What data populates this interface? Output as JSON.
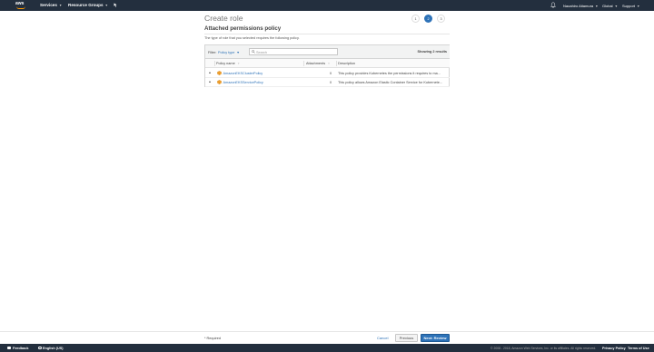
{
  "topbar": {
    "logo": "aws",
    "services": "Services",
    "resource_groups": "Resource Groups",
    "user": "Naoahiro Aitamura",
    "region": "Global",
    "support": "Support"
  },
  "page": {
    "title": "Create role",
    "steps": [
      "1",
      "2",
      "3"
    ],
    "active_step": "2",
    "subtitle": "Attached permissions policy",
    "description": "The type of role that you selected requires the following policy."
  },
  "table": {
    "filter_label": "Filter:",
    "filter_value": "Policy type",
    "search_placeholder": "Search",
    "results": "Showing 2 results",
    "columns": {
      "name": "Policy name",
      "attachments": "Attachments",
      "description": "Description"
    },
    "rows": [
      {
        "name": "AmazonEKSClusterPolicy",
        "attachments": "0",
        "description": "This policy provides Kubernetes the permissions it requires to ma..."
      },
      {
        "name": "AmazonEKSServicePolicy",
        "attachments": "0",
        "description": "This policy allows Amazon Elastic Container Service for Kubernete..."
      }
    ]
  },
  "footer": {
    "required": "* Required",
    "cancel": "Cancel",
    "previous": "Previous",
    "next": "Next: Review"
  },
  "bottombar": {
    "feedback": "Feedback",
    "language": "English (US)",
    "copyright": "© 2008 - 2018, Amazon Web Services, Inc. or its affiliates. All rights reserved.",
    "privacy": "Privacy Policy",
    "terms": "Terms of Use"
  },
  "colors": {
    "topbar": "#232f3e",
    "link": "#2e73b8",
    "accent": "#ff9900"
  }
}
